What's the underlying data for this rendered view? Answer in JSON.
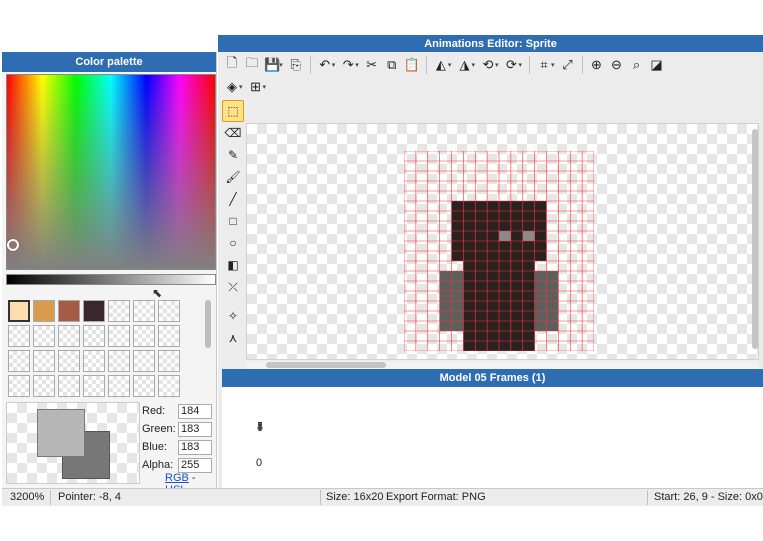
{
  "colors": {
    "titlebar": "#2f6db3",
    "grid_line": "#ff3333",
    "sprite_dark": "#2b2121",
    "sprite_gray": "#5e5e5e",
    "eye": "#8a8a8a",
    "preview_front": "#b8b7b7",
    "preview_back": "#777777"
  },
  "palette": {
    "title": "Color palette",
    "swatches": [
      {
        "color": "#fddcb0",
        "selected": true
      },
      {
        "color": "#d89c4c"
      },
      {
        "color": "#a45c43"
      },
      {
        "color": "#3a262c"
      },
      {},
      {},
      {},
      {},
      {},
      {},
      {},
      {},
      {},
      {},
      {},
      {},
      {},
      {},
      {},
      {},
      {},
      {},
      {},
      {},
      {},
      {},
      {},
      {}
    ],
    "rgb": {
      "red_label": "Red:",
      "red": "184",
      "green_label": "Green:",
      "green": "183",
      "blue_label": "Blue:",
      "blue": "183",
      "alpha_label": "Alpha:",
      "alpha": "255"
    },
    "mode_rgb": "RGB",
    "mode_sep": "-",
    "mode_hsl": "HSL"
  },
  "editor": {
    "title": "Animations Editor: Sprite",
    "toolbar_row1": [
      {
        "icon": "new-file-icon",
        "glyph": "🗋"
      },
      {
        "icon": "open-folder-icon",
        "glyph": "🗀"
      },
      {
        "icon": "save-icon",
        "glyph": "💾",
        "dropdown": true
      },
      {
        "icon": "export-icon",
        "glyph": "⎘"
      },
      {
        "sep": true
      },
      {
        "icon": "undo-icon",
        "glyph": "↶",
        "dropdown": true
      },
      {
        "icon": "redo-icon",
        "glyph": "↷",
        "dropdown": true
      },
      {
        "icon": "cut-icon",
        "glyph": "✂"
      },
      {
        "icon": "copy-icon",
        "glyph": "⧉"
      },
      {
        "icon": "paste-icon",
        "glyph": "📋"
      },
      {
        "sep": true
      },
      {
        "icon": "flip-horizontal-icon",
        "glyph": "◭",
        "dropdown": true
      },
      {
        "icon": "flip-vertical-icon",
        "glyph": "◮",
        "dropdown": true
      },
      {
        "icon": "rotate-left-icon",
        "glyph": "⟲",
        "dropdown": true
      },
      {
        "icon": "rotate-right-icon",
        "glyph": "⟳",
        "dropdown": true
      },
      {
        "sep": true
      },
      {
        "icon": "crop-icon",
        "glyph": "⌗",
        "dropdown": true
      },
      {
        "icon": "resize-icon",
        "glyph": "⤢"
      },
      {
        "sep": true
      },
      {
        "icon": "zoom-in-icon",
        "glyph": "⊕"
      },
      {
        "icon": "zoom-out-icon",
        "glyph": "⊖"
      },
      {
        "icon": "zoom-fit-icon",
        "glyph": "⌕"
      },
      {
        "icon": "transparency-icon",
        "glyph": "◪"
      }
    ],
    "toolbar_row2": [
      {
        "icon": "layers-icon",
        "glyph": "◈",
        "dropdown": true
      },
      {
        "icon": "grid-icon",
        "glyph": "⊞",
        "dropdown": true
      }
    ],
    "side_tools": [
      {
        "icon": "select-rect-icon",
        "glyph": "⬚",
        "active": true
      },
      {
        "icon": "eraser-icon",
        "glyph": "⌫"
      },
      {
        "icon": "pencil-icon",
        "glyph": "✎"
      },
      {
        "icon": "brush-icon",
        "glyph": "🖌"
      },
      {
        "icon": "line-icon",
        "glyph": "╱"
      },
      {
        "icon": "rectangle-icon",
        "glyph": "□"
      },
      {
        "icon": "ellipse-icon",
        "glyph": "○"
      },
      {
        "icon": "fill-bucket-icon",
        "glyph": "◧"
      },
      {
        "icon": "eyedropper-icon",
        "glyph": "⤫"
      },
      {
        "sep": true
      },
      {
        "icon": "magic-wand-icon",
        "glyph": "✧"
      },
      {
        "icon": "polygon-icon",
        "glyph": "⋏"
      }
    ],
    "sprite": {
      "cols": 16,
      "rows": 20,
      "rows_data": [
        "................",
        "................",
        "................",
        "................",
        "................",
        "....DDDDDDDD....",
        "....DDDDDDDD....",
        "....DDDDDDDD....",
        "....DDDDEDED....",
        "....DDDDDDDD....",
        "....DDDDDDDD....",
        ".....DDDDDD.....",
        "...GGDDDDDDGG...",
        "...GGDDDDDDGG...",
        "...GGDDDDDDGG...",
        "...GGDDDDDDGG...",
        "...GGDDDDDDGG...",
        "...GGDDDDDDGG...",
        ".....DDDDDD.....",
        ".....DDDDDD....."
      ]
    },
    "frames_title": "Model 05 Frames (1)",
    "frame_number": "0"
  },
  "status": {
    "zoom": "3200%",
    "pointer": "Pointer: -8, 4",
    "size": "Size: 16x20",
    "export_format": "Export Format: PNG",
    "selection": "Start: 26, 9 - Size: 0x0"
  }
}
